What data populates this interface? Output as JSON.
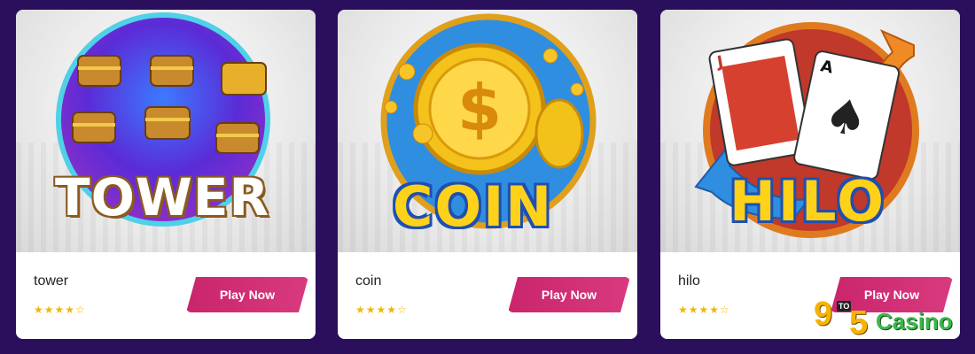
{
  "cards": [
    {
      "name": "tower",
      "title_art": "TOWER",
      "rating": "★★★★☆",
      "button_label": "Play Now"
    },
    {
      "name": "coin",
      "title_art": "COIN",
      "rating": "★★★★☆",
      "button_label": "Play Now"
    },
    {
      "name": "hilo",
      "title_art": "HILO",
      "rating": "★★★★☆",
      "button_label": "Play Now"
    }
  ],
  "logo": {
    "nine": "9",
    "to": "TO",
    "five": "5",
    "casino": "Casino"
  },
  "colors": {
    "background": "#2a0f5c",
    "button": "#c9256c",
    "star": "#f2b705",
    "logo_green": "#3cb54a",
    "logo_gold": "#f4b400"
  }
}
